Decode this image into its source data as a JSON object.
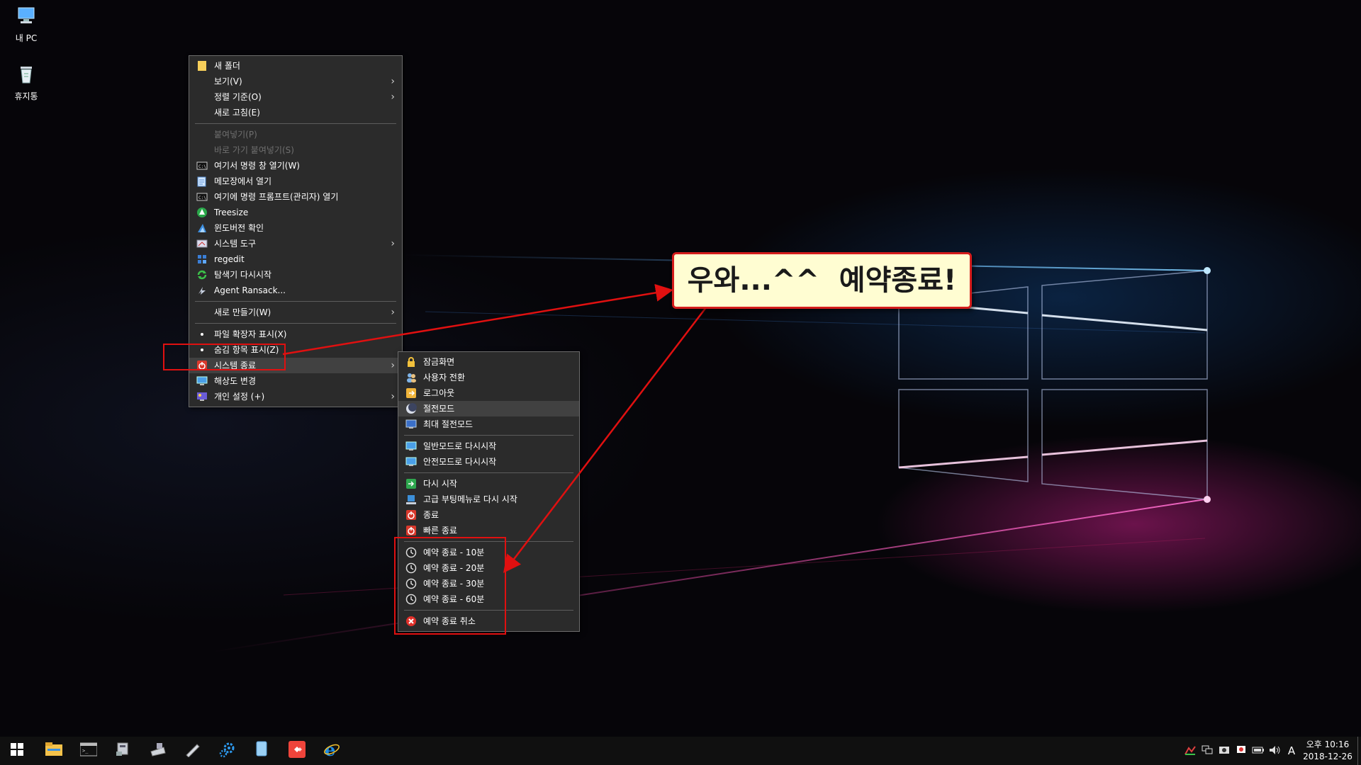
{
  "desktop": {
    "icons": [
      {
        "label": "내 PC",
        "icon": "computer-icon"
      },
      {
        "label": "휴지통",
        "icon": "recycle-bin-icon"
      }
    ]
  },
  "context_menu": {
    "items": [
      {
        "label": "새 폴더",
        "icon": "folder-icon"
      },
      {
        "label": "보기(V)",
        "submenu": true
      },
      {
        "label": "정렬 기준(O)",
        "submenu": true
      },
      {
        "label": "새로 고침(E)"
      },
      {
        "label": "붙여넣기(P)",
        "disabled": true
      },
      {
        "label": "바로 가기 붙여넣기(S)",
        "disabled": true
      },
      {
        "label": "여기서 명령 창 열기(W)",
        "icon": "cmd-icon"
      },
      {
        "label": "메모장에서 열기",
        "icon": "notepad-icon"
      },
      {
        "label": "여기에 명령 프롬프트(관리자) 열기",
        "icon": "cmd-admin-icon"
      },
      {
        "label": "Treesize",
        "icon": "treesize-icon"
      },
      {
        "label": "윈도버전 확인",
        "icon": "winver-icon"
      },
      {
        "label": "시스템 도구",
        "icon": "system-tools-icon",
        "submenu": true
      },
      {
        "label": "regedit",
        "icon": "regedit-icon"
      },
      {
        "label": "탐색기 다시시작",
        "icon": "refresh-icon"
      },
      {
        "label": "Agent Ransack...",
        "icon": "agent-ransack-icon"
      },
      {
        "label": "새로 만들기(W)",
        "submenu": true
      },
      {
        "label": "파일 확장자 표시(X)",
        "bullet": true
      },
      {
        "label": "숨김 항목 표시(Z)",
        "bullet": true
      },
      {
        "label": "시스템 종료",
        "icon": "power-icon",
        "submenu": true
      },
      {
        "label": "해상도 변경",
        "icon": "monitor-icon"
      },
      {
        "label": "개인 설정 (+)",
        "icon": "personalize-icon",
        "submenu": true
      }
    ]
  },
  "shutdown_submenu": {
    "items": [
      {
        "label": "잠금화면",
        "icon": "lock-icon"
      },
      {
        "label": "사용자 전환",
        "icon": "switch-user-icon"
      },
      {
        "label": "로그아웃",
        "icon": "logout-icon"
      },
      {
        "label": "절전모드",
        "icon": "sleep-icon"
      },
      {
        "label": "최대 절전모드",
        "icon": "hibernate-icon"
      },
      {
        "label": "일반모드로 다시시작",
        "icon": "restart-normal-icon"
      },
      {
        "label": "안전모드로 다시시작",
        "icon": "restart-safe-icon"
      },
      {
        "label": "다시 시작",
        "icon": "restart-icon"
      },
      {
        "label": "고급 부팅메뉴로 다시 시작",
        "icon": "advanced-boot-icon"
      },
      {
        "label": "종료",
        "icon": "shutdown-icon"
      },
      {
        "label": "빠른 종료",
        "icon": "fast-shutdown-icon"
      },
      {
        "label": "예약 종료 - 10분",
        "icon": "timer-icon"
      },
      {
        "label": "예약 종료 - 20분",
        "icon": "timer-icon"
      },
      {
        "label": "예약 종료 - 30분",
        "icon": "timer-icon"
      },
      {
        "label": "예약 종료 - 60분",
        "icon": "timer-icon"
      },
      {
        "label": "예약 종료 취소",
        "icon": "cancel-icon"
      }
    ]
  },
  "annotation": {
    "callout_text": "우와...^^  예약종료!",
    "color": "#e01010"
  },
  "taskbar": {
    "buttons": [
      "start-icon",
      "file-explorer-icon",
      "command-prompt-icon",
      "network-icon",
      "scanner-icon",
      "pen-icon",
      "settings-gear-icon",
      "document-icon",
      "anydesk-icon",
      "internet-explorer-icon"
    ],
    "tray": {
      "ime": "A",
      "clock_time": "오후 10:16",
      "clock_date": "2018-12-26"
    }
  }
}
